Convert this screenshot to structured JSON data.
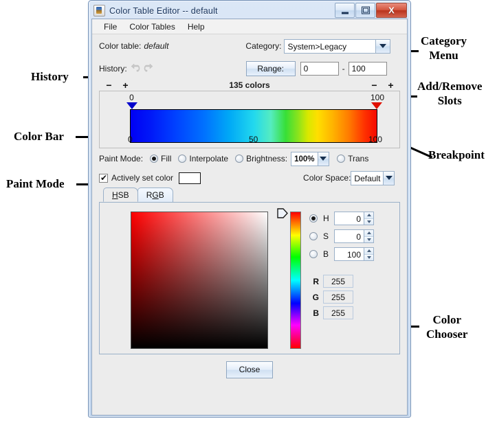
{
  "annotations": [
    {
      "id": "history",
      "text": "History"
    },
    {
      "id": "color_bar",
      "text": "Color Bar"
    },
    {
      "id": "paint_mode",
      "text": "Paint Mode"
    },
    {
      "id": "category_menu",
      "text": "Category\nMenu"
    },
    {
      "id": "add_remove_slots",
      "text": "Add/Remove\nSlots"
    },
    {
      "id": "breakpoint",
      "text": "Breakpoint"
    },
    {
      "id": "color_chooser",
      "text": "Color\nChooser"
    }
  ],
  "window": {
    "title": "Color Table Editor -- default",
    "icon": "java-coffee-cup-icon",
    "buttons": {
      "minimize": "minimize-icon",
      "maximize": "maximize-icon",
      "close": "X"
    }
  },
  "menubar": {
    "items": [
      {
        "label": "File"
      },
      {
        "label": "Color Tables"
      },
      {
        "label": "Help"
      }
    ]
  },
  "toolbar": {
    "color_table_label": "Color table:",
    "color_table_value": "default",
    "category_label": "Category:",
    "category_value": "System>Legacy",
    "history_label": "History:",
    "range_button": "Range:",
    "range_min": "0",
    "range_max": "100",
    "range_separator": "-",
    "minus": "−",
    "plus": "+",
    "color_count": "135 colors"
  },
  "colorbar": {
    "left_breakpoint_value": "0",
    "right_breakpoint_value": "100",
    "axis_ticks": [
      "0",
      "50",
      "100"
    ]
  },
  "paint_mode": {
    "label": "Paint Mode:",
    "options": [
      {
        "label": "Fill",
        "selected": true
      },
      {
        "label": "Interpolate",
        "selected": false
      },
      {
        "label": "Brightness:",
        "selected": false
      },
      {
        "label": "Trans",
        "selected": false
      }
    ],
    "brightness_value": "100%"
  },
  "actively_set": {
    "label": "Actively set color",
    "checked": true,
    "swatch_color": "#ffffff"
  },
  "color_space": {
    "label": "Color Space:",
    "value": "Default"
  },
  "chooser": {
    "tabs": [
      {
        "label": "HSB",
        "mnemonic": "H",
        "selected": true
      },
      {
        "label": "RGB",
        "mnemonic": "G",
        "selected": false
      }
    ],
    "hsb": [
      {
        "name": "H",
        "value": "0",
        "selected": true
      },
      {
        "name": "S",
        "value": "0",
        "selected": false
      },
      {
        "name": "B",
        "value": "100",
        "selected": false
      }
    ],
    "rgb": [
      {
        "name": "R",
        "value": "255"
      },
      {
        "name": "G",
        "value": "255"
      },
      {
        "name": "B",
        "value": "255"
      }
    ]
  },
  "footer": {
    "close_button": "Close"
  }
}
